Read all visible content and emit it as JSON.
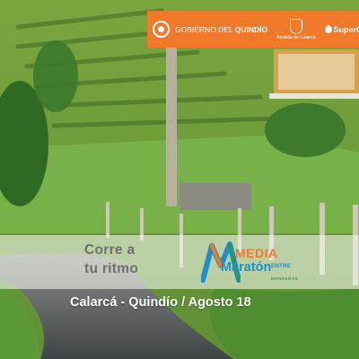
{
  "sponsors": {
    "gobierno_prefix": "GOBIERNO DEL ",
    "gobierno_name": "QUINDÍO",
    "alcaldia": "Alcaldía de Calarcá",
    "supergiros": "SuperGIROS"
  },
  "event": {
    "tagline_line1": "Corre a",
    "tagline_line2": "tu ritmo",
    "logo_media": "MEDIA",
    "logo_maraton": "Maratón",
    "logo_entre": "ENTRE",
    "logo_montanas": "MONTAÑAS",
    "location_date": "Calarcá - Quindío  / Agosto 18"
  },
  "colors": {
    "brand_orange": "#f07a2a",
    "brand_blue": "#1f8fc6",
    "brand_green": "#2f9b3a"
  }
}
